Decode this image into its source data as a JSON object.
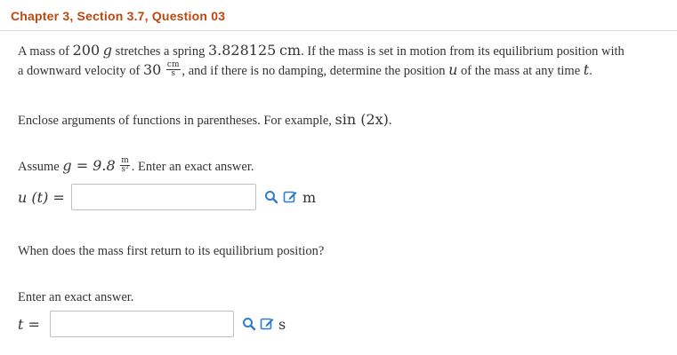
{
  "header": {
    "title": "Chapter 3, Section 3.7, Question 03"
  },
  "problem": {
    "l1_a": "A mass of ",
    "mass": "200",
    "g_unit": "g",
    "l1_b": " stretches a spring ",
    "stretch": "3.828125",
    "cm_unit": "cm",
    "l1_c": ". If the mass is set in motion from its equilibrium position with",
    "l2_a": "a downward velocity of ",
    "velocity": "30",
    "vel_num": "cm",
    "vel_den": "s",
    "l2_b": ", and if there is no damping, determine the position ",
    "u_var": "u",
    "l2_c": " of the mass at any time ",
    "t_var": "t",
    "l2_d": "."
  },
  "instruction": {
    "text": "Enclose arguments of functions in parentheses. For example, ",
    "example": "sin (2x)",
    "end": "."
  },
  "assume": {
    "text": "Assume ",
    "eq": "g = 9.8",
    "unit_num": "m",
    "unit_den": "s²",
    "rest": ". Enter an exact answer."
  },
  "answer1": {
    "label": "u (t) =",
    "value": "",
    "unit": "m"
  },
  "question2": {
    "text": "When does the mass first return to its equilibrium position?"
  },
  "instruction2": {
    "text": "Enter an exact answer."
  },
  "answer2": {
    "label": "t =",
    "value": "",
    "unit": "s"
  },
  "icons": [
    "search-icon",
    "edit-icon"
  ],
  "colors": {
    "header": "#c0460e",
    "icon": "#2e7bcf"
  }
}
